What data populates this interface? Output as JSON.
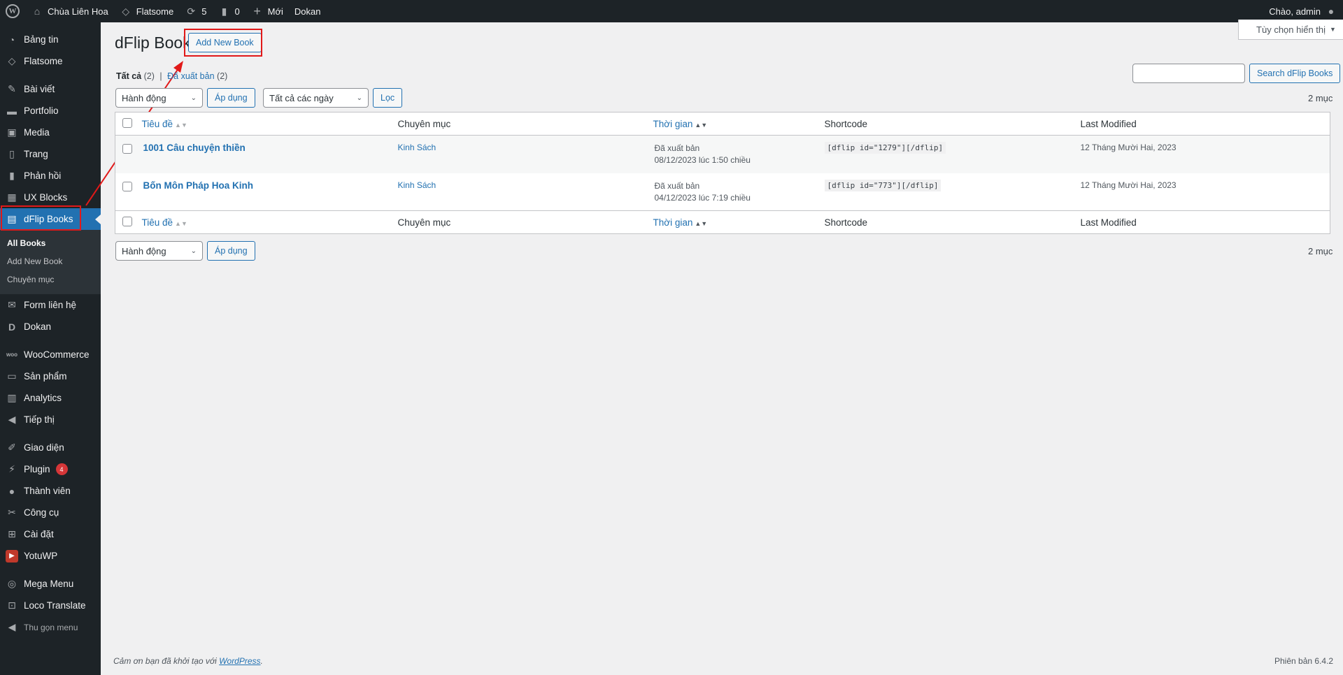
{
  "adminbar": {
    "site_name": "Chùa Liên Hoa",
    "theme": "Flatsome",
    "updates_count": "5",
    "comments_count": "0",
    "new_label": "Mới",
    "dokan": "Dokan",
    "greeting": "Chào, admin"
  },
  "sidebar": {
    "items": [
      {
        "label": "Bảng tin",
        "icon": "dashboard-icon"
      },
      {
        "label": "Flatsome",
        "icon": "flatsome-icon"
      },
      {
        "label": "Bài viết",
        "icon": "pin-icon"
      },
      {
        "label": "Portfolio",
        "icon": "folder-icon"
      },
      {
        "label": "Media",
        "icon": "media-icon"
      },
      {
        "label": "Trang",
        "icon": "page-icon"
      },
      {
        "label": "Phản hồi",
        "icon": "comment-icon"
      },
      {
        "label": "UX Blocks",
        "icon": "blocks-icon"
      },
      {
        "label": "dFlip Books",
        "icon": "book-icon"
      },
      {
        "label": "Form liên hệ",
        "icon": "mail-icon"
      },
      {
        "label": "Dokan",
        "icon": "dokan-icon"
      },
      {
        "label": "WooCommerce",
        "icon": "woo-icon"
      },
      {
        "label": "Sản phẩm",
        "icon": "archive-icon"
      },
      {
        "label": "Analytics",
        "icon": "chart-icon"
      },
      {
        "label": "Tiếp thị",
        "icon": "megaphone-icon"
      },
      {
        "label": "Giao diện",
        "icon": "brush-icon"
      },
      {
        "label": "Plugin",
        "icon": "plugin-icon",
        "badge": "4"
      },
      {
        "label": "Thành viên",
        "icon": "user-icon"
      },
      {
        "label": "Công cụ",
        "icon": "wrench-icon"
      },
      {
        "label": "Cài đặt",
        "icon": "settings-icon"
      },
      {
        "label": "YotuWP",
        "icon": "youtube-icon"
      },
      {
        "label": "Mega Menu",
        "icon": "megamenu-icon"
      },
      {
        "label": "Loco Translate",
        "icon": "translate-icon"
      }
    ],
    "submenu": [
      "All Books",
      "Add New Book",
      "Chuyên mục"
    ],
    "collapse_label": "Thu gọn menu"
  },
  "header": {
    "title": "dFlip Book",
    "add_new_label": "Add New Book",
    "screen_options": "Tùy chọn hiển thị"
  },
  "views": {
    "all_label": "Tất cả",
    "all_count": "(2)",
    "published_label": "Đã xuất bản",
    "published_count": "(2)"
  },
  "search": {
    "value": "",
    "button_label": "Search dFlip Books"
  },
  "filters": {
    "bulk_action": "Hành động",
    "apply_label": "Áp dụng",
    "date_filter": "Tất cả các ngày",
    "filter_label": "Lọc"
  },
  "item_count": "2 mục",
  "table": {
    "columns": [
      "Tiêu đề",
      "Chuyên mục",
      "Thời gian",
      "Shortcode",
      "Last Modified"
    ],
    "rows": [
      {
        "title": "1001 Câu chuyện thiền",
        "category": "Kinh Sách",
        "status": "Đã xuất bản",
        "date": "08/12/2023 lúc 1:50 chiều",
        "shortcode": "[dflip id=\"1279\"][/dflip]",
        "modified": "12 Tháng Mười Hai, 2023"
      },
      {
        "title": "Bốn Môn Pháp Hoa Kinh",
        "category": "Kinh Sách",
        "status": "Đã xuất bản",
        "date": "04/12/2023 lúc 7:19 chiều",
        "shortcode": "[dflip id=\"773\"][/dflip]",
        "modified": "12 Tháng Mười Hai, 2023"
      }
    ]
  },
  "footer": {
    "thanks_prefix": "Cảm ơn bạn đã khởi tạo với",
    "wordpress_link": "WordPress",
    "version": "Phiên bản 6.4.2"
  },
  "colors": {
    "sidebar_bg": "#1d2327",
    "accent": "#2271b1",
    "highlight": "#e11919",
    "badge": "#d63638"
  }
}
